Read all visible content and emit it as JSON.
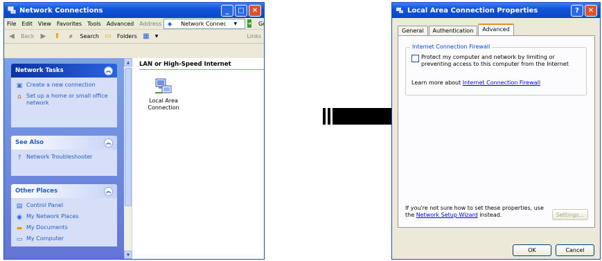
{
  "explorer": {
    "title": "Network Connections",
    "menu": [
      "File",
      "Edit",
      "View",
      "Favorites",
      "Tools",
      "Advanced"
    ],
    "toolbar": {
      "back_label": "Back",
      "search_label": "Search",
      "folders_label": "Folders",
      "address_label": "Address",
      "address_value": "Network Connections",
      "go_label": "Go",
      "links_label": "Links"
    },
    "tasks": {
      "network_tasks": {
        "header": "Network Tasks",
        "items": [
          "Create a new connection",
          "Set up a home or small office network"
        ]
      },
      "see_also": {
        "header": "See Also",
        "items": [
          "Network Troubleshooter"
        ]
      },
      "other_places": {
        "header": "Other Places",
        "items": [
          "Control Panel",
          "My Network Places",
          "My Documents",
          "My Computer"
        ]
      }
    },
    "content": {
      "group_header": "LAN or High-Speed Internet",
      "connection_label": "Local Area Connection"
    }
  },
  "dialog": {
    "title": "Local Area Connection Properties",
    "tabs": [
      "General",
      "Authentication",
      "Advanced"
    ],
    "active_tab": "Advanced",
    "firewall_group": "Internet Connection Firewall",
    "checkbox_label": "Protect my computer and network by limiting or preventing access to this computer from the Internet",
    "learn_more_prefix": "Learn more about",
    "learn_more_link": "Internet Connection Firewall",
    "bottom_text_prefix": "If you're not sure how to set these properties, use the",
    "bottom_link": "Network Setup Wizard",
    "bottom_text_suffix": "instead.",
    "settings_button": "Settings...",
    "ok_button": "OK",
    "cancel_button": "Cancel"
  },
  "colors": {
    "xp_blue": "#0a46c8",
    "task_pane": "#6375d6",
    "link": "#215dc6"
  }
}
